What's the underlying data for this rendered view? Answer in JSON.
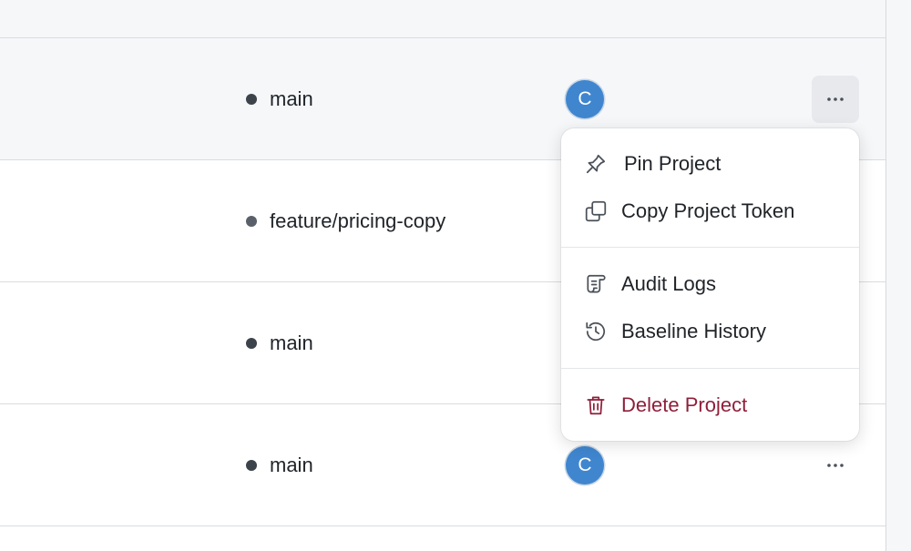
{
  "rows": [
    {
      "branch": "main",
      "avatar_initial": "C",
      "hovered": true
    },
    {
      "branch": "feature/pricing-copy"
    },
    {
      "branch": "main"
    },
    {
      "branch": "main",
      "avatar_initial": "C"
    }
  ],
  "context_menu": {
    "items": [
      {
        "label": "Pin Project",
        "icon": "pin-icon"
      },
      {
        "label": "Copy Project Token",
        "icon": "copy-icon"
      },
      {
        "label": "Audit Logs",
        "icon": "scroll-icon"
      },
      {
        "label": "Baseline History",
        "icon": "history-icon"
      },
      {
        "label": "Delete Project",
        "icon": "trash-icon",
        "color": "#8f1f3a"
      }
    ]
  },
  "colors": {
    "avatar": "#3f86cf",
    "danger": "#8f1f3a",
    "hover_row": "#f6f7f9"
  }
}
